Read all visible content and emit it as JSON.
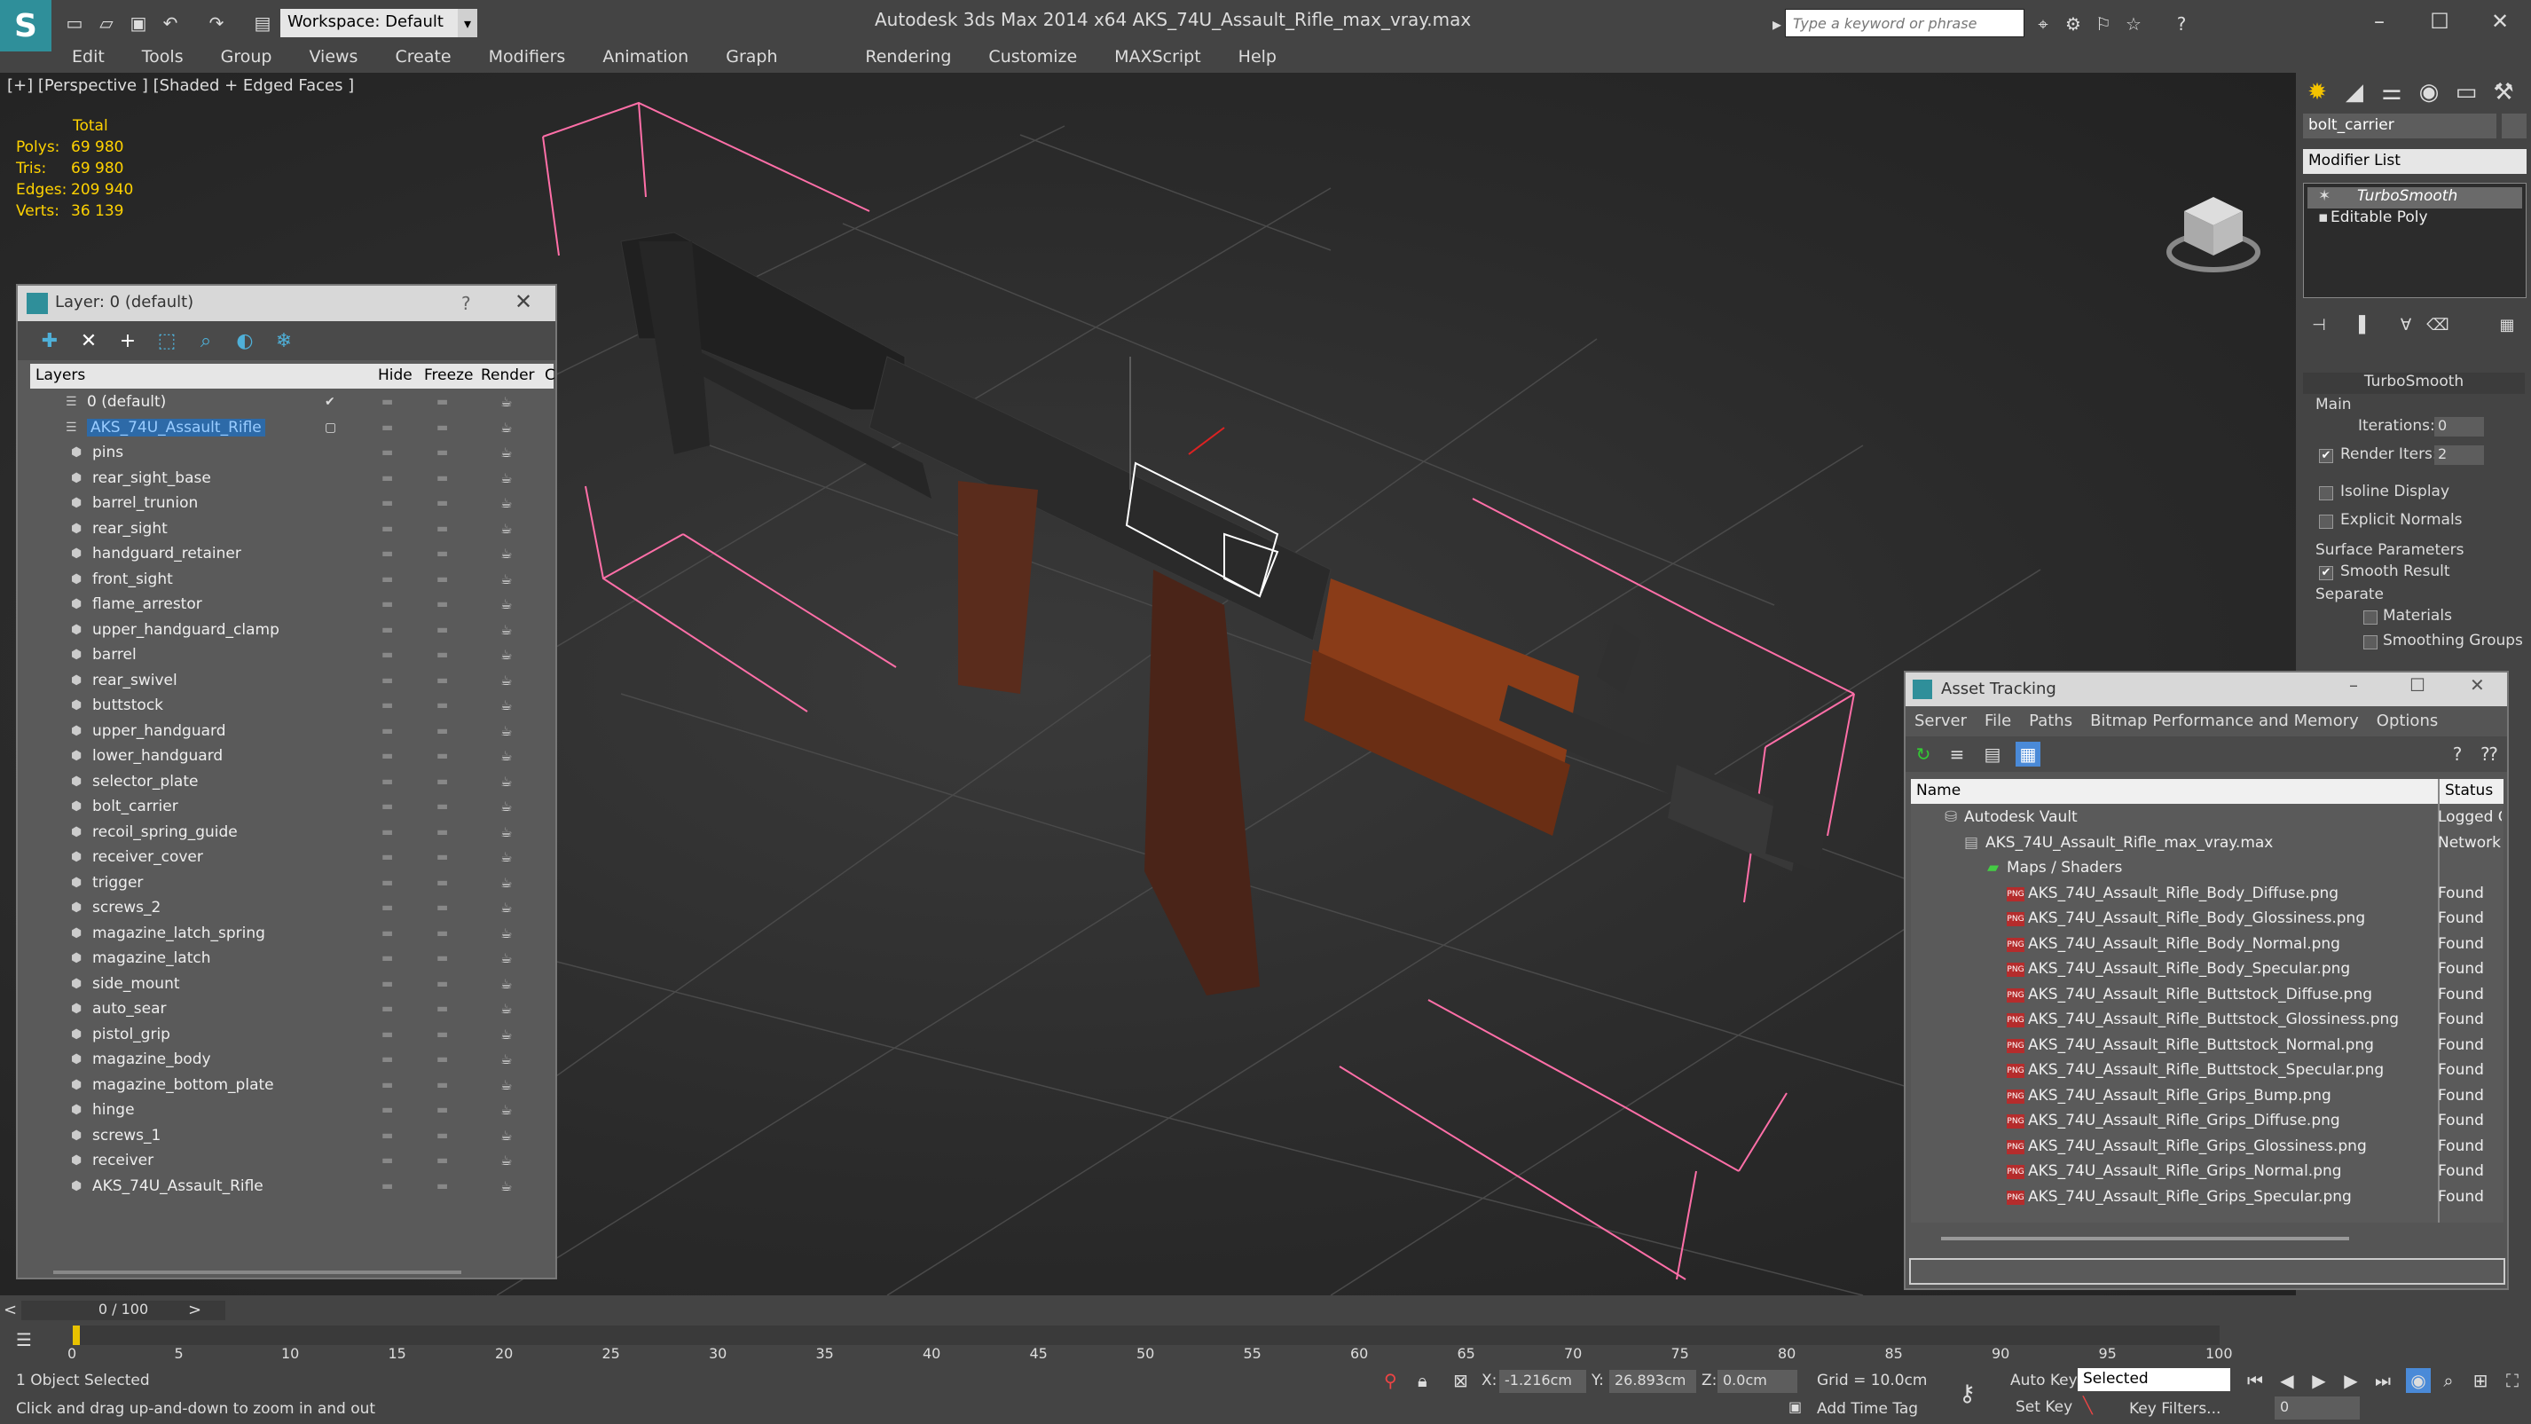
{
  "window": {
    "title": "Autodesk 3ds Max  2014 x64     AKS_74U_Assault_Rifle_max_vray.max",
    "workspace": "Workspace: Default",
    "search_placeholder": "Type a keyword or phrase",
    "logo_glyph": "S"
  },
  "menu": [
    "Edit",
    "Tools",
    "Group",
    "Views",
    "Create",
    "Modifiers",
    "Animation",
    "Graph Editors",
    "Rendering",
    "Customize",
    "MAXScript",
    "Help"
  ],
  "viewport": {
    "label": "[+] [Perspective ] [Shaded + Edged Faces ]",
    "stats": {
      "header": "Total",
      "rows": [
        {
          "label": "Polys:",
          "value": "69 980"
        },
        {
          "label": "Tris:",
          "value": "69 980"
        },
        {
          "label": "Edges:",
          "value": "209 940"
        },
        {
          "label": "Verts:",
          "value": "36 139"
        }
      ]
    }
  },
  "layer_dialog": {
    "title": "Layer: 0 (default)",
    "help": "?",
    "columns": {
      "layers": "Layers",
      "hide": "Hide",
      "freeze": "Freeze",
      "render": "Render",
      "extra": "C"
    },
    "top_layers": [
      {
        "name": "0 (default)",
        "checked": true
      },
      {
        "name": "AKS_74U_Assault_Rifle",
        "selected": true
      }
    ],
    "objects": [
      "pins",
      "rear_sight_base",
      "barrel_trunion",
      "rear_sight",
      "handguard_retainer",
      "front_sight",
      "flame_arrestor",
      "upper_handguard_clamp",
      "barrel",
      "rear_swivel",
      "buttstock",
      "upper_handguard",
      "lower_handguard",
      "selector_plate",
      "bolt_carrier",
      "recoil_spring_guide",
      "receiver_cover",
      "trigger",
      "screws_2",
      "magazine_latch_spring",
      "magazine_latch",
      "side_mount",
      "auto_sear",
      "pistol_grip",
      "magazine_body",
      "magazine_bottom_plate",
      "hinge",
      "screws_1",
      "receiver",
      "AKS_74U_Assault_Rifle"
    ]
  },
  "command_panel": {
    "object_name": "bolt_carrier",
    "modifier_list": "Modifier List",
    "stack": [
      {
        "name": "TurboSmooth",
        "active": true
      },
      {
        "name": "Editable Poly",
        "active": false
      }
    ],
    "rollout_title": "TurboSmooth",
    "main_label": "Main",
    "iterations_label": "Iterations:",
    "iterations_value": "0",
    "render_iters_label": "Render Iters:",
    "render_iters_value": "2",
    "render_iters_checked": true,
    "isoline_label": "Isoline Display",
    "explicit_normals_label": "Explicit Normals",
    "surface_params_label": "Surface Parameters",
    "smooth_result_label": "Smooth Result",
    "smooth_result_checked": true,
    "separate_label": "Separate",
    "materials_label": "Materials",
    "smoothing_groups_label": "Smoothing Groups"
  },
  "asset_tracking": {
    "title": "Asset Tracking",
    "menu": [
      "Server",
      "File",
      "Paths",
      "Bitmap Performance and Memory",
      "Options"
    ],
    "col_name": "Name",
    "col_status": "Status",
    "vault": {
      "name": "Autodesk Vault",
      "status": "Logged O"
    },
    "file": {
      "name": "AKS_74U_Assault_Rifle_max_vray.max",
      "status": "Network P"
    },
    "group": "Maps / Shaders",
    "icon_text": "PNG",
    "maps": [
      {
        "name": "AKS_74U_Assault_Rifle_Body_Diffuse.png",
        "status": "Found"
      },
      {
        "name": "AKS_74U_Assault_Rifle_Body_Glossiness.png",
        "status": "Found"
      },
      {
        "name": "AKS_74U_Assault_Rifle_Body_Normal.png",
        "status": "Found"
      },
      {
        "name": "AKS_74U_Assault_Rifle_Body_Specular.png",
        "status": "Found"
      },
      {
        "name": "AKS_74U_Assault_Rifle_Buttstock_Diffuse.png",
        "status": "Found"
      },
      {
        "name": "AKS_74U_Assault_Rifle_Buttstock_Glossiness.png",
        "status": "Found"
      },
      {
        "name": "AKS_74U_Assault_Rifle_Buttstock_Normal.png",
        "status": "Found"
      },
      {
        "name": "AKS_74U_Assault_Rifle_Buttstock_Specular.png",
        "status": "Found"
      },
      {
        "name": "AKS_74U_Assault_Rifle_Grips_Bump.png",
        "status": "Found"
      },
      {
        "name": "AKS_74U_Assault_Rifle_Grips_Diffuse.png",
        "status": "Found"
      },
      {
        "name": "AKS_74U_Assault_Rifle_Grips_Glossiness.png",
        "status": "Found"
      },
      {
        "name": "AKS_74U_Assault_Rifle_Grips_Normal.png",
        "status": "Found"
      },
      {
        "name": "AKS_74U_Assault_Rifle_Grips_Specular.png",
        "status": "Found"
      }
    ]
  },
  "timeline": {
    "frame": "0 / 100",
    "ticks": [
      "0",
      "5",
      "10",
      "15",
      "20",
      "25",
      "30",
      "35",
      "40",
      "45",
      "50",
      "55",
      "60",
      "65",
      "70",
      "75",
      "80",
      "85",
      "90",
      "95",
      "100"
    ]
  },
  "status_bar": {
    "selection": "1 Object Selected",
    "prompt": "Click and drag up-and-down to zoom in and out",
    "x_label": "X:",
    "x_value": "-1.216cm",
    "y_label": "Y:",
    "y_value": "26.893cm",
    "z_label": "Z:",
    "z_value": "0.0cm",
    "grid": "Grid = 10.0cm",
    "auto_key": "Auto Key",
    "set_key": "Set Key",
    "selected": "Selected",
    "key_filters": "Key Filters...",
    "add_time_tag": "Add Time Tag",
    "frame_value": "0"
  },
  "colors": {
    "accent_teal": "#2f8f9a",
    "selection_blue": "#2d6aa8",
    "stats_yellow": "#ffd200",
    "bbox_pink": "#ff6fa8",
    "png_red": "#b52c2c"
  }
}
